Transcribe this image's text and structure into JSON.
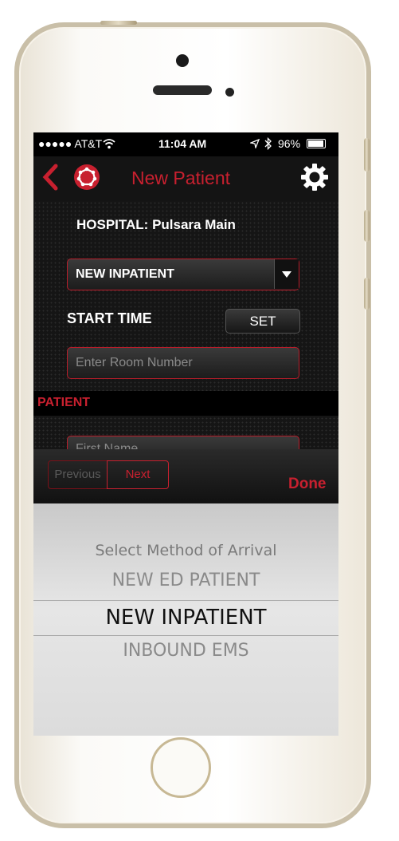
{
  "status_bar": {
    "carrier": "●●●●● AT&T",
    "time": "11:04 AM",
    "battery": "96%"
  },
  "nav": {
    "title": "New Patient",
    "back_icon": "chevron-left-icon",
    "logo_icon": "pulsara-logo-icon",
    "settings_icon": "gear-icon"
  },
  "form": {
    "hospital_label": "HOSPITAL: Pulsara Main",
    "arrival_select": "NEW INPATIENT",
    "start_time_label": "START TIME",
    "set_button": "SET",
    "room_placeholder": "Enter Room Number",
    "section_header": "PATIENT",
    "first_name_placeholder": "First Name"
  },
  "keyboard_toolbar": {
    "previous": "Previous",
    "next": "Next",
    "done": "Done"
  },
  "picker": {
    "title": "Select Method of Arrival",
    "options": [
      "NEW ED PATIENT",
      "NEW INPATIENT",
      "INBOUND EMS"
    ],
    "selected": "NEW INPATIENT"
  },
  "colors": {
    "accent": "#c8202f",
    "background": "#141414",
    "picker_bg": "#dcdcdc"
  }
}
